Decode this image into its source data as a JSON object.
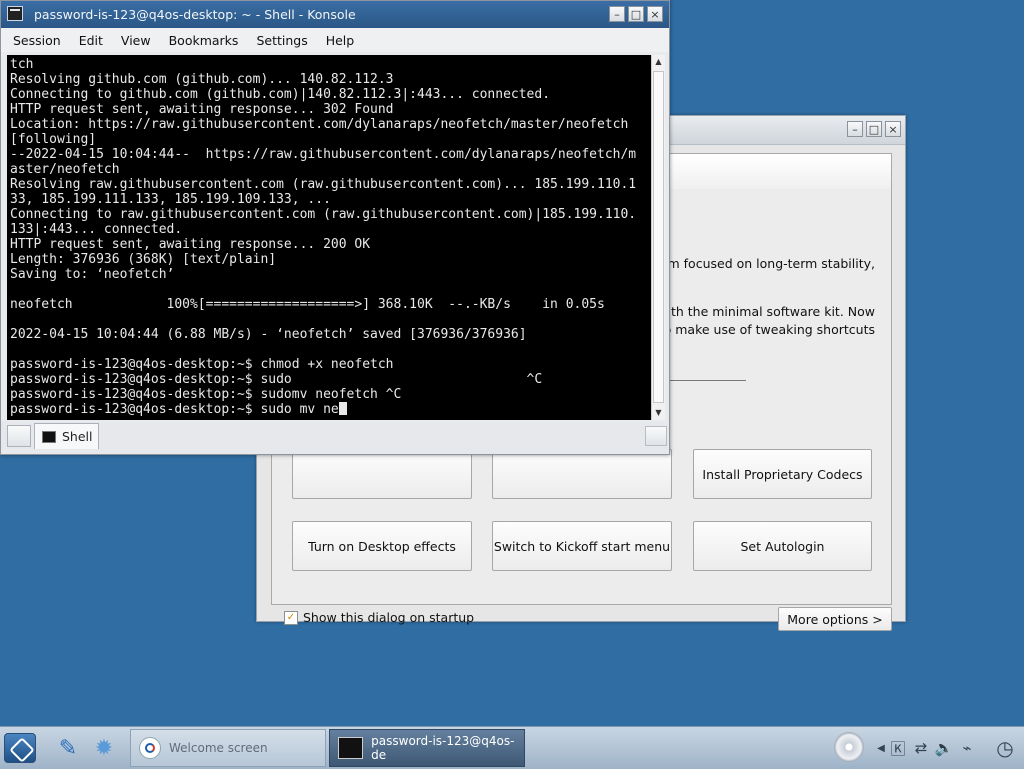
{
  "welcome": {
    "description_lines": [
      "m focused on long-term stability,",
      "with the minimal software kit. Now",
      "o make use of tweaking shortcuts"
    ],
    "buttons": [
      {
        "label": "Install Proprietary Codecs"
      },
      {
        "label": "Turn on Desktop effects"
      },
      {
        "label": "Switch to Kickoff start menu"
      },
      {
        "label": "Set Autologin"
      }
    ],
    "show_on_startup_label": "Show this dialog on startup",
    "show_on_startup_checked": true,
    "more_options_label": "More options  >"
  },
  "konsole": {
    "title": "password-is-123@q4os-desktop: ~ - Shell - Konsole",
    "menu": [
      "Session",
      "Edit",
      "View",
      "Bookmarks",
      "Settings",
      "Help"
    ],
    "terminal_lines": [
      "tch",
      "Resolving github.com (github.com)... 140.82.112.3",
      "Connecting to github.com (github.com)|140.82.112.3|:443... connected.",
      "HTTP request sent, awaiting response... 302 Found",
      "Location: https://raw.githubusercontent.com/dylanaraps/neofetch/master/neofetch",
      "[following]",
      "--2022-04-15 10:04:44--  https://raw.githubusercontent.com/dylanaraps/neofetch/m",
      "aster/neofetch",
      "Resolving raw.githubusercontent.com (raw.githubusercontent.com)... 185.199.110.1",
      "33, 185.199.111.133, 185.199.109.133, ...",
      "Connecting to raw.githubusercontent.com (raw.githubusercontent.com)|185.199.110.",
      "133|:443... connected.",
      "HTTP request sent, awaiting response... 200 OK",
      "Length: 376936 (368K) [text/plain]",
      "Saving to: ‘neofetch’",
      "",
      "neofetch            100%[===================>] 368.10K  --.-KB/s    in 0.05s",
      "",
      "2022-04-15 10:04:44 (6.88 MB/s) - ‘neofetch’ saved [376936/376936]",
      "",
      "password-is-123@q4os-desktop:~$ chmod +x neofetch",
      "password-is-123@q4os-desktop:~$ sudo                              ^C",
      "password-is-123@q4os-desktop:~$ sudomv neofetch ^C"
    ],
    "prompt_line": "password-is-123@q4os-desktop:~$ sudo mv ne",
    "tab_label": "Shell"
  },
  "taskbar": {
    "tasks": [
      {
        "label": "Welcome screen",
        "active": false
      },
      {
        "label": "password-is-123@q4os-de",
        "active": true
      }
    ]
  },
  "icons": {
    "start": "start-menu-icon",
    "file_manager": "file-manager-icon",
    "settings": "settings-gear-icon",
    "tray": [
      "arrow-left-icon",
      "keyboard-k-icon",
      "network-icon",
      "volume-icon",
      "usb-icon",
      "clock-icon"
    ]
  }
}
